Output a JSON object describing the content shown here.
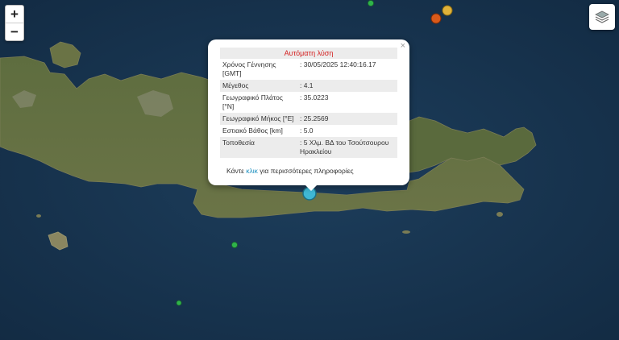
{
  "map": {
    "colors": {
      "sea": "#1b3a57",
      "sea_deep": "#132c45",
      "land": "#5b6b3c",
      "land_dark": "#3e4d2b",
      "mountain": "#9a9a84"
    },
    "controls": {
      "zoom_in_label": "+",
      "zoom_out_label": "−",
      "layers_icon": "layers-icon"
    }
  },
  "popup": {
    "title": "Αυτόματη λύση",
    "close_label": "×",
    "rows": [
      {
        "key": "Χρόνος Γέννησης [GMT]",
        "value": ": 30/05/2025 12:40:16.17"
      },
      {
        "key": "Μέγεθος",
        "value": ": 4.1"
      },
      {
        "key": "Γεωγραφικό Πλάτος [°N]",
        "value": ": 35.0223"
      },
      {
        "key": "Γεωγραφικό Μήκος [°E]",
        "value": ": 25.2569"
      },
      {
        "key": "Εστιακό Βάθος [km]",
        "value": ": 5.0"
      },
      {
        "key": "Τοποθεσία",
        "value": ": 5 Χλμ. ΒΔ του Τσούτσουρου Ηρακλείου"
      }
    ],
    "footer_before": "Κάντε ",
    "footer_link": "κλικ",
    "footer_after": " για περισσότερες πληροφορίες"
  },
  "markers": [
    {
      "name": "selected-quake",
      "color": "#3fb8d4"
    },
    {
      "name": "quake-marker",
      "color": "#e0a42a"
    },
    {
      "name": "quake-marker",
      "color": "#d95a1a"
    },
    {
      "name": "quake-marker",
      "color": "#2fb34a"
    }
  ]
}
